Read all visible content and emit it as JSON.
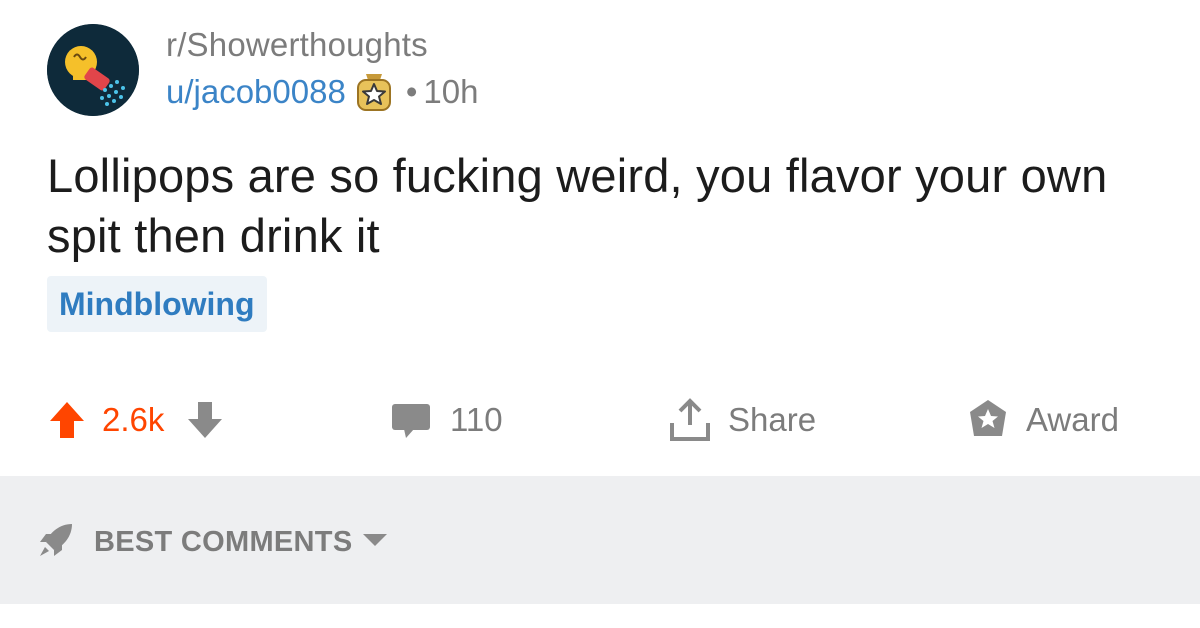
{
  "post": {
    "subreddit": "r/Showerthoughts",
    "username": "u/jacob0088",
    "separator": "•",
    "age": "10h",
    "title": "Lollipops are so fucking weird, you flavor your own spit then drink it",
    "flair": "Mindblowing"
  },
  "actions": {
    "score": "2.6k",
    "comments": "110",
    "share_label": "Share",
    "award_label": "Award"
  },
  "sort": {
    "label": "BEST COMMENTS"
  },
  "colors": {
    "upvote": "#ff4500",
    "username": "#3b84c7",
    "flair_text": "#2f7cc0",
    "flair_bg": "#edf3f8",
    "muted": "#7c7c7c",
    "sort_bar_bg": "#eeeff1"
  },
  "icons": {
    "subreddit_avatar": "lightbulb-shower-icon",
    "user_badge": "star-badge-icon",
    "upvote": "arrow-up-icon",
    "downvote": "arrow-down-icon",
    "comments": "comment-bubble-icon",
    "share": "share-upload-icon",
    "award": "award-star-icon",
    "sort": "rocket-icon",
    "dropdown": "caret-down-icon"
  }
}
